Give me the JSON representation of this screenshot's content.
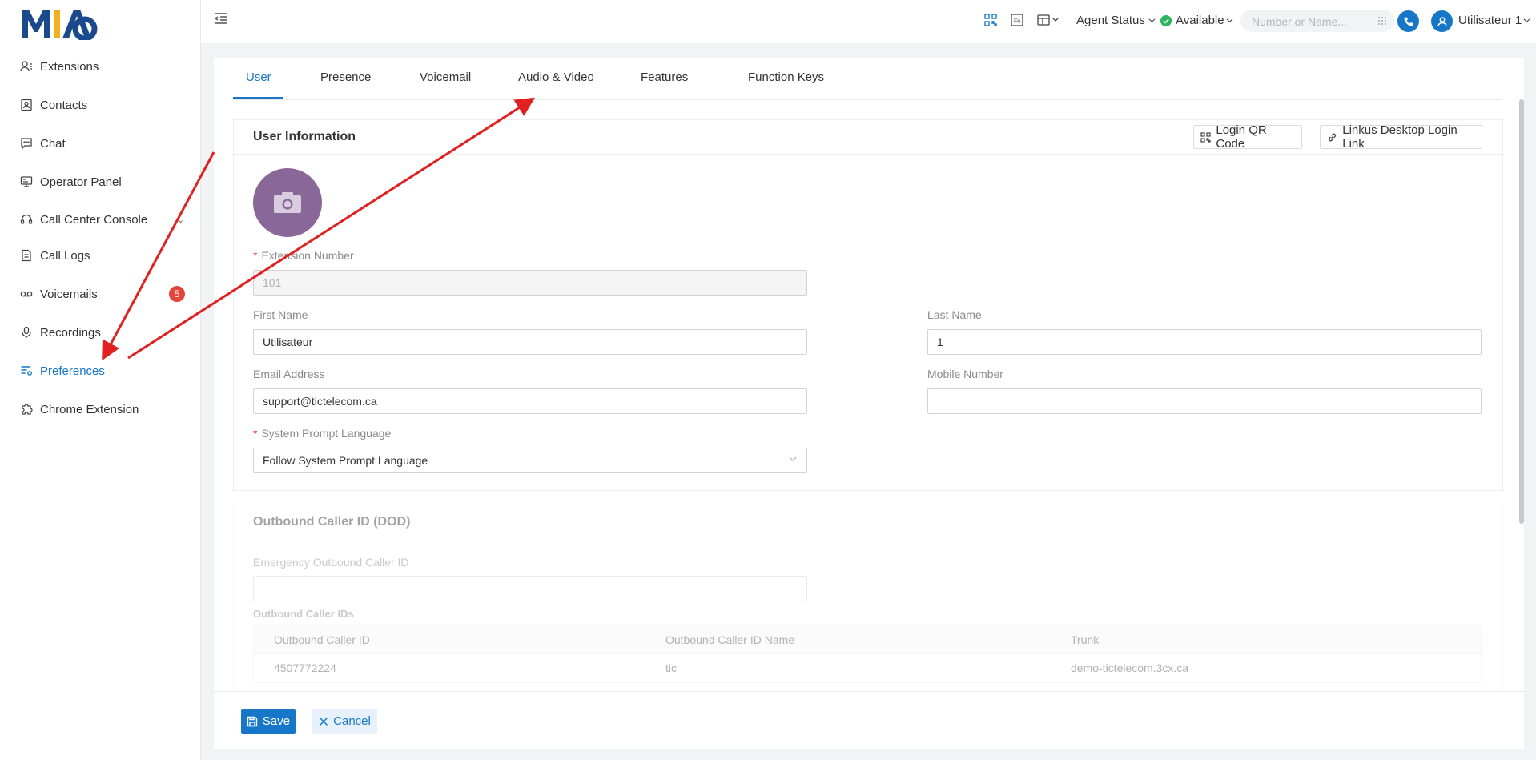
{
  "brand": {
    "logo_text": "MIA",
    "colors": {
      "accent": "#1677c8",
      "logo_blue": "#1a4a8c",
      "logo_yellow": "#f2b01e",
      "badge": "#e5443a",
      "annotation_arrow": "#e0211f"
    }
  },
  "sidebar": {
    "items": [
      {
        "label": "Extensions",
        "icon": "extensions-icon"
      },
      {
        "label": "Contacts",
        "icon": "contacts-icon"
      },
      {
        "label": "Chat",
        "icon": "chat-icon"
      },
      {
        "label": "Operator Panel",
        "icon": "operator-panel-icon"
      },
      {
        "label": "Call Center Console",
        "icon": "headset-icon"
      },
      {
        "label": "Call Logs",
        "icon": "call-logs-icon"
      },
      {
        "label": "Voicemails",
        "icon": "voicemail-icon",
        "badge": "5"
      },
      {
        "label": "Recordings",
        "icon": "microphone-icon"
      },
      {
        "label": "Preferences",
        "icon": "preferences-icon",
        "active": true
      },
      {
        "label": "Chrome Extension",
        "icon": "puzzle-icon"
      }
    ]
  },
  "header": {
    "agent_status": "Agent Status",
    "availability": "Available",
    "search_placeholder": "Number or Name...",
    "user_name": "Utilisateur 1"
  },
  "tabs": [
    "User",
    "Presence",
    "Voicemail",
    "Audio & Video",
    "Features",
    "Function Keys"
  ],
  "user_info": {
    "title": "User Information",
    "qr_button": "Login QR Code",
    "desktop_link_button": "Linkus Desktop Login Link",
    "extension_label": "Extension Number",
    "extension_value": "101",
    "first_name_label": "First Name",
    "first_name_value": "Utilisateur",
    "last_name_label": "Last Name",
    "last_name_value": "1",
    "email_label": "Email Address",
    "email_value": "support@tictelecom.ca",
    "mobile_label": "Mobile Number",
    "mobile_value": "",
    "language_label": "System Prompt Language",
    "language_value": "Follow System Prompt Language"
  },
  "outbound": {
    "title": "Outbound Caller ID (DOD)",
    "emergency_label": "Emergency Outbound Caller ID",
    "emergency_value": "",
    "ids_label": "Outbound Caller IDs",
    "columns": [
      "Outbound Caller ID",
      "Outbound Caller ID Name",
      "Trunk"
    ],
    "rows": [
      {
        "id": "4507772224",
        "name": "tic",
        "trunk": "demo-tictelecom.3cx.ca"
      }
    ]
  },
  "footer": {
    "save": "Save",
    "cancel": "Cancel"
  }
}
